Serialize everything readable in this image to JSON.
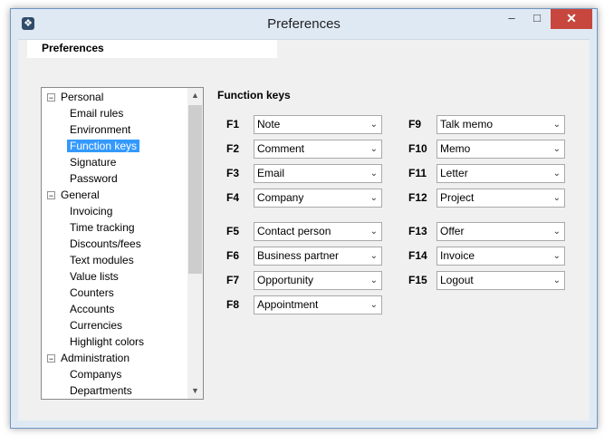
{
  "window": {
    "title": "Preferences",
    "minimize": "–",
    "maximize": "□",
    "close": "✕"
  },
  "header": {
    "title": "Preferences"
  },
  "tree": {
    "items": [
      {
        "label": "Personal",
        "group": true
      },
      {
        "label": "Email rules",
        "group": false
      },
      {
        "label": "Environment",
        "group": false
      },
      {
        "label": "Function keys",
        "group": false,
        "selected": true
      },
      {
        "label": "Signature",
        "group": false
      },
      {
        "label": "Password",
        "group": false
      },
      {
        "label": "General",
        "group": true
      },
      {
        "label": "Invoicing",
        "group": false
      },
      {
        "label": "Time tracking",
        "group": false
      },
      {
        "label": "Discounts/fees",
        "group": false
      },
      {
        "label": "Text modules",
        "group": false
      },
      {
        "label": "Value lists",
        "group": false
      },
      {
        "label": "Counters",
        "group": false
      },
      {
        "label": "Accounts",
        "group": false
      },
      {
        "label": "Currencies",
        "group": false
      },
      {
        "label": "Highlight colors",
        "group": false
      },
      {
        "label": "Administration",
        "group": true
      },
      {
        "label": "Companys",
        "group": false
      },
      {
        "label": "Departments",
        "group": false
      }
    ]
  },
  "function_keys": {
    "heading": "Function keys",
    "left": [
      {
        "key": "F1",
        "value": "Note"
      },
      {
        "key": "F2",
        "value": "Comment"
      },
      {
        "key": "F3",
        "value": "Email"
      },
      {
        "key": "F4",
        "value": "Company"
      },
      {
        "key": "F5",
        "value": "Contact person"
      },
      {
        "key": "F6",
        "value": "Business partner"
      },
      {
        "key": "F7",
        "value": "Opportunity"
      },
      {
        "key": "F8",
        "value": "Appointment"
      }
    ],
    "right": [
      {
        "key": "F9",
        "value": "Talk memo"
      },
      {
        "key": "F10",
        "value": "Memo"
      },
      {
        "key": "F11",
        "value": "Letter"
      },
      {
        "key": "F12",
        "value": "Project"
      },
      {
        "key": "F13",
        "value": "Offer"
      },
      {
        "key": "F14",
        "value": "Invoice"
      },
      {
        "key": "F15",
        "value": "Logout"
      }
    ]
  }
}
